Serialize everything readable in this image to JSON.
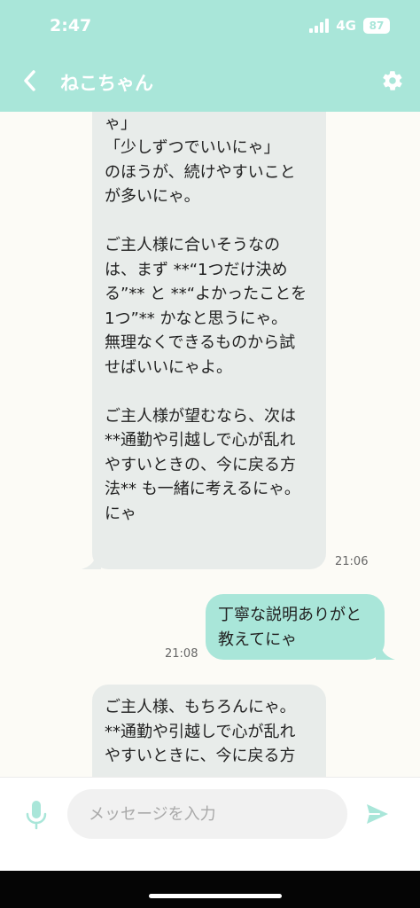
{
  "status_bar": {
    "time": "2:47",
    "network": "4G",
    "battery": "87"
  },
  "header": {
    "title": "ねこちゃん",
    "back_icon": "chevron-left-icon",
    "settings_icon": "gear-icon"
  },
  "messages": [
    {
      "sender": "other",
      "text": "「今日はここまででいいに\nゃ」\n「少しずつでいいにゃ」\nのほうが、続けやすいこと\nが多いにゃ。\n\nご主人様に合いそうなの\nは、まず **“1つだけ決め\nる”** と **“よかったことを\n1つ”** かなと思うにゃ。\n無理なくできるものから試\nせばいいにゃよ。\n\nご主人様が望むなら、次は\n**通勤や引越しで心が乱れ\nやすいときの、今に戻る方\n法** も一緒に考えるにゃ。\nにゃ",
      "time": "21:06"
    },
    {
      "sender": "me",
      "text": "丁寧な説明ありがと\n教えてにゃ",
      "time": "21:08"
    },
    {
      "sender": "other",
      "text": "ご主人様、もちろんにゃ。\n**通勤や引越しで心が乱れ\nやすいときに、今に戻る方"
    }
  ],
  "composer": {
    "placeholder": "メッセージを入力",
    "mic_icon": "microphone-icon",
    "send_icon": "send-icon"
  },
  "colors": {
    "accent": "#a9e6d9",
    "incoming_bubble": "#e8ecea",
    "background": "#fcfbf6"
  }
}
